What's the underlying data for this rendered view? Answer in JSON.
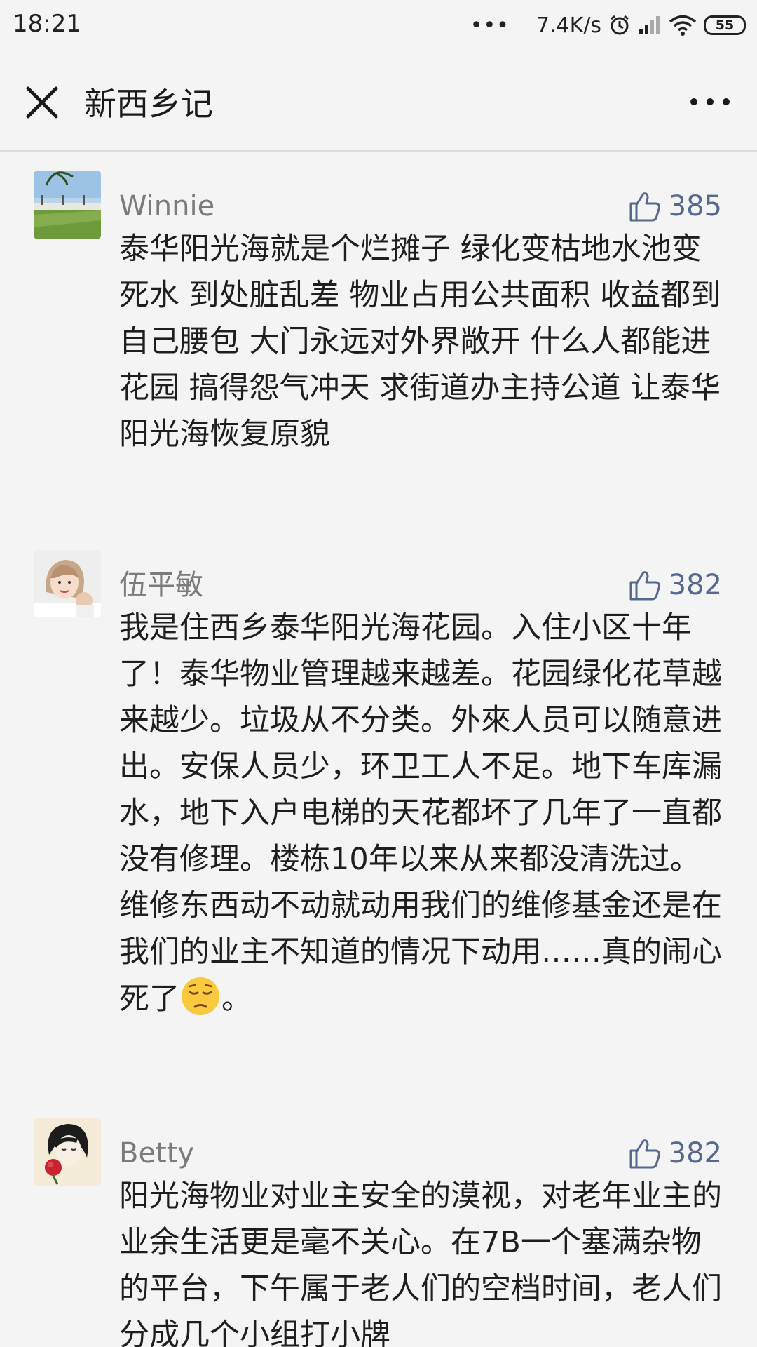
{
  "status": {
    "time": "18:21",
    "dots": "•••",
    "speed": "7.4K/s",
    "battery": "55"
  },
  "nav": {
    "title": "新西乡记"
  },
  "comments": [
    {
      "nickname": "Winnie",
      "likes": "385",
      "text": "泰华阳光海就是个烂摊子 绿化变枯地水池变死水 到处脏乱差 物业占用公共面积 收益都到自己腰包 大门永远对外界敞开 什么人都能进花园 搞得怨气冲天 求街道办主持公道 让泰华阳光海恢复原貌"
    },
    {
      "nickname": "伍平敏",
      "likes": "382",
      "text": "我是住西乡泰华阳光海花园。入住小区十年了！泰华物业管理越来越差。花园绿化花草越来越少。垃圾从不分类。外來人员可以随意进出。安保人员少，环卫工人不足。地下车库漏水，地下入户电梯的天花都坏了几年了一直都没有修理。楼栋10年以来从来都没清洗过。维修东西动不动就动用我们的维修基金还是在我们的业主不知道的情况下动用……真的闹心死了",
      "text_after_emoji": "。",
      "emoji": "pensive-face"
    },
    {
      "nickname": "Betty",
      "likes": "382",
      "text": "阳光海物业对业主安全的漠视，对老年业主的业余生活更是毫不关心。在7B一个塞满杂物的平台，下午属于老人们的空档时间，老人们分成几个小组打小牌"
    }
  ]
}
